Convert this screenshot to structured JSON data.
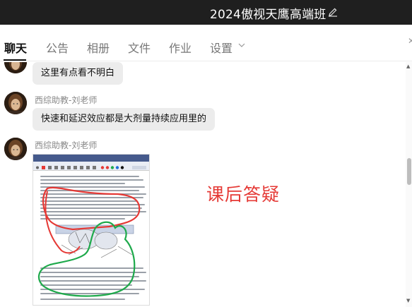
{
  "window": {
    "title": "2024傲视天鹰高端班"
  },
  "tabs": [
    {
      "label": "聊天",
      "active": true
    },
    {
      "label": "公告"
    },
    {
      "label": "相册"
    },
    {
      "label": "文件"
    },
    {
      "label": "作业"
    },
    {
      "label": "设置"
    }
  ],
  "messages": [
    {
      "text": "这里有点看不明白"
    },
    {
      "sender": "西综助教-刘老师",
      "text": "快速和延迟效应都是大剂量持续应用里的"
    },
    {
      "sender": "西综助教-刘老师"
    }
  ],
  "annotation": {
    "text": "课后答疑",
    "color": "#e53935"
  },
  "colors": {
    "titlebar": "#1f1f1f",
    "bubble": "#ececec",
    "accent_red": "#e53935",
    "ink_green": "#1ea94b"
  },
  "icons": [
    "edit-icon",
    "chevron-down-icon",
    "close-icon",
    "avatar",
    "scroll-up-icon",
    "scroll-down-icon"
  ]
}
